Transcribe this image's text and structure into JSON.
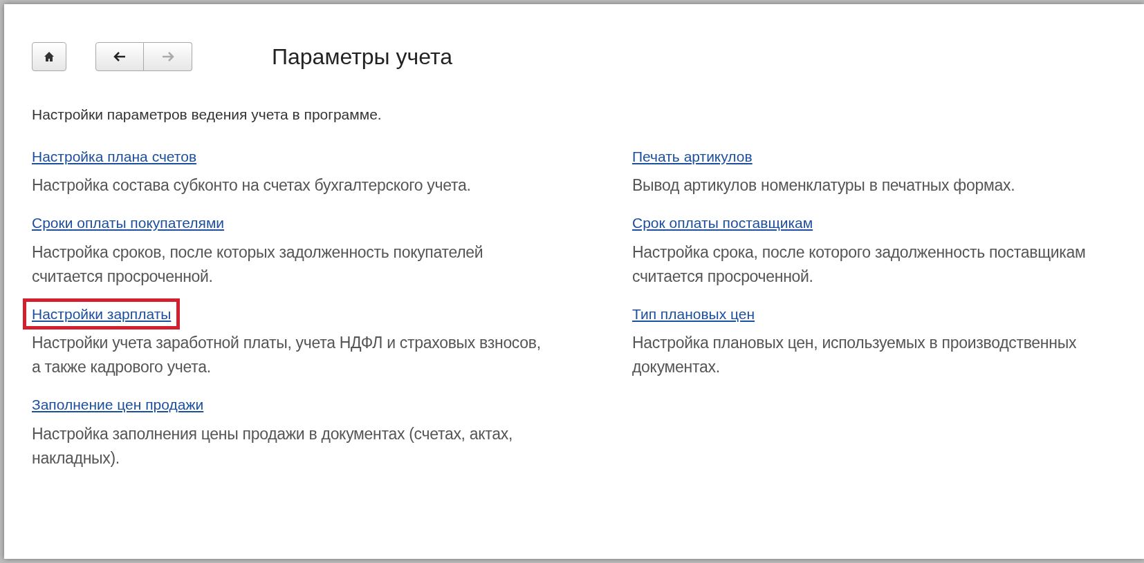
{
  "title": "Параметры учета",
  "description": "Настройки параметров ведения учета в программе.",
  "columns": [
    {
      "items": [
        {
          "link": "Настройка плана счетов",
          "text": "Настройка состава субконто на счетах бухгалтерского учета.",
          "highlighted": false
        },
        {
          "link": "Сроки оплаты покупателями",
          "text": "Настройка сроков, после которых задолженность покупателей считается просроченной.",
          "highlighted": false
        },
        {
          "link": "Настройки зарплаты",
          "text": "Настройки учета заработной платы, учета НДФЛ и страховых взносов, а также кадрового учета.",
          "highlighted": true
        },
        {
          "link": "Заполнение цен продажи",
          "text": "Настройка заполнения цены продажи в документах (счетах, актах, накладных).",
          "highlighted": false
        }
      ]
    },
    {
      "items": [
        {
          "link": "Печать артикулов",
          "text": "Вывод артикулов номенклатуры в печатных формах.",
          "highlighted": false
        },
        {
          "link": "Срок оплаты поставщикам",
          "text": "Настройка срока, после которого задолженность поставщикам считается просроченной.",
          "highlighted": false
        },
        {
          "link": "Тип плановых цен",
          "text": "Настройка плановых цен, используемых в производственных документах.",
          "highlighted": false
        }
      ]
    }
  ]
}
